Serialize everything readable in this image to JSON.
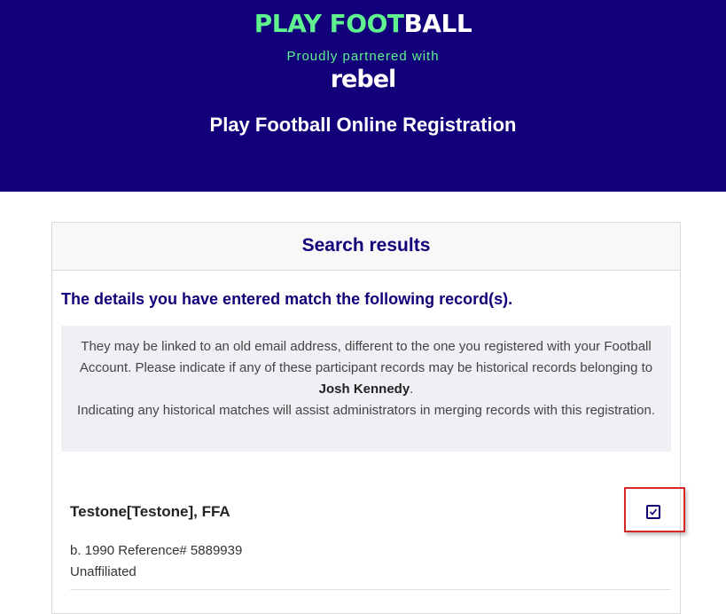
{
  "header": {
    "logo_part1": "PLAY FOOT",
    "logo_part2": "BALL",
    "partner_text": "Proudly partnered with",
    "partner_logo": "rebel",
    "title": "Play Football Online Registration"
  },
  "panel": {
    "title": "Search results",
    "match_heading": "The details you have entered match the following record(s).",
    "info_line1": "They may be linked to an old email address, different to the one you registered with your Football Account. Please indicate if any of these participant records may be historical records belonging to ",
    "info_name": "Josh Kennedy",
    "info_line1_end": ".",
    "info_line2": "Indicating any historical matches will assist administrators in merging records with this registration."
  },
  "record": {
    "name": "Testone[Testone], FFA",
    "birth_ref": "b. 1990 Reference# 5889939",
    "affiliation": "Unaffiliated",
    "checked": true
  },
  "colors": {
    "brand_navy": "#12007a",
    "brand_green": "#5ff28e",
    "highlight_red": "#d62828"
  },
  "icons": {
    "checkbox": "check-icon"
  }
}
